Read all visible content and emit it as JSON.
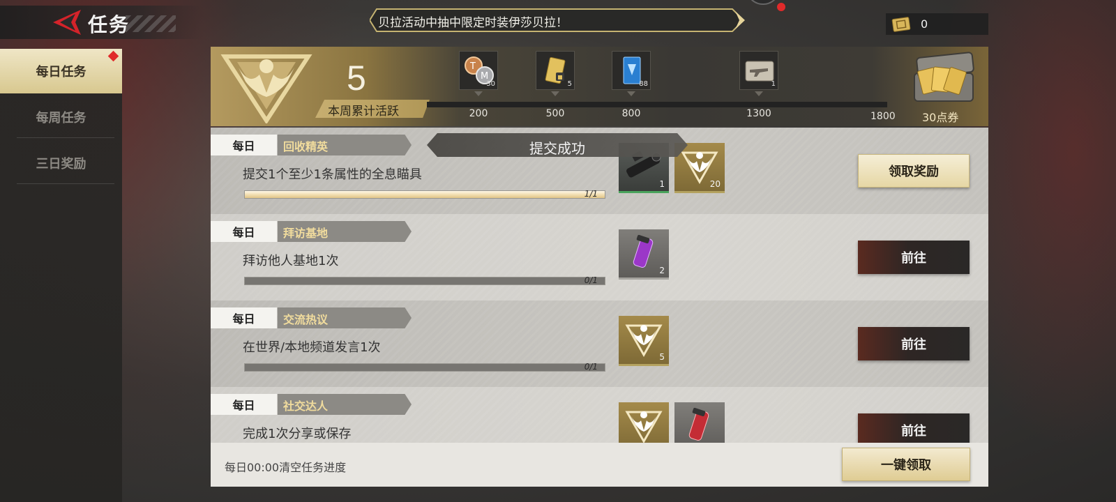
{
  "header": {
    "title": "任务",
    "marquee": "贝拉活动中抽中限定时装伊莎贝拉！",
    "currency_value": "0"
  },
  "sidebar": {
    "items": [
      {
        "label": "每日任务",
        "active": true
      },
      {
        "label": "每周任务",
        "active": false
      },
      {
        "label": "三日奖励",
        "active": false
      }
    ]
  },
  "activity": {
    "current": "5",
    "label": "本周累计活跃",
    "milestones": [
      {
        "threshold": "200",
        "count": "30",
        "icon": "coin-medal-icon"
      },
      {
        "threshold": "500",
        "count": "5",
        "icon": "gold-ticket-icon"
      },
      {
        "threshold": "800",
        "count": "88",
        "icon": "blue-card-icon"
      },
      {
        "threshold": "1300",
        "count": "1",
        "icon": "weapon-case-icon"
      }
    ],
    "final_threshold": "1800",
    "final_reward_label": "30点券",
    "progress_fraction": 0.0
  },
  "toast": "提交成功",
  "quests": [
    {
      "frequency": "每日",
      "name": "回收精英",
      "desc": "提交1个至少1条属性的全息瞄具",
      "progress_text": "1/1",
      "progress_fraction": 1.0,
      "rewards": [
        {
          "icon": "scope-icon",
          "count": "1"
        },
        {
          "icon": "activity-emblem-icon",
          "count": "20"
        }
      ],
      "action": "领取奖励"
    },
    {
      "frequency": "每日",
      "name": "拜访基地",
      "desc": "拜访他人基地1次",
      "progress_text": "0/1",
      "progress_fraction": 0.0,
      "rewards": [
        {
          "icon": "purple-vial-icon",
          "count": "2"
        }
      ],
      "action": "前往"
    },
    {
      "frequency": "每日",
      "name": "交流热议",
      "desc": "在世界/本地频道发言1次",
      "progress_text": "0/1",
      "progress_fraction": 0.0,
      "rewards": [
        {
          "icon": "activity-emblem-icon",
          "count": "5"
        }
      ],
      "action": "前往"
    },
    {
      "frequency": "每日",
      "name": "社交达人",
      "desc": "完成1次分享或保存",
      "action": "前往"
    }
  ],
  "footer": {
    "note": "每日00:00清空任务进度",
    "claim_all": "一键领取"
  },
  "colors": {
    "accent_gold": "#d8c88f",
    "go_button": "#2a2827",
    "alert_red": "#e02a2a"
  }
}
